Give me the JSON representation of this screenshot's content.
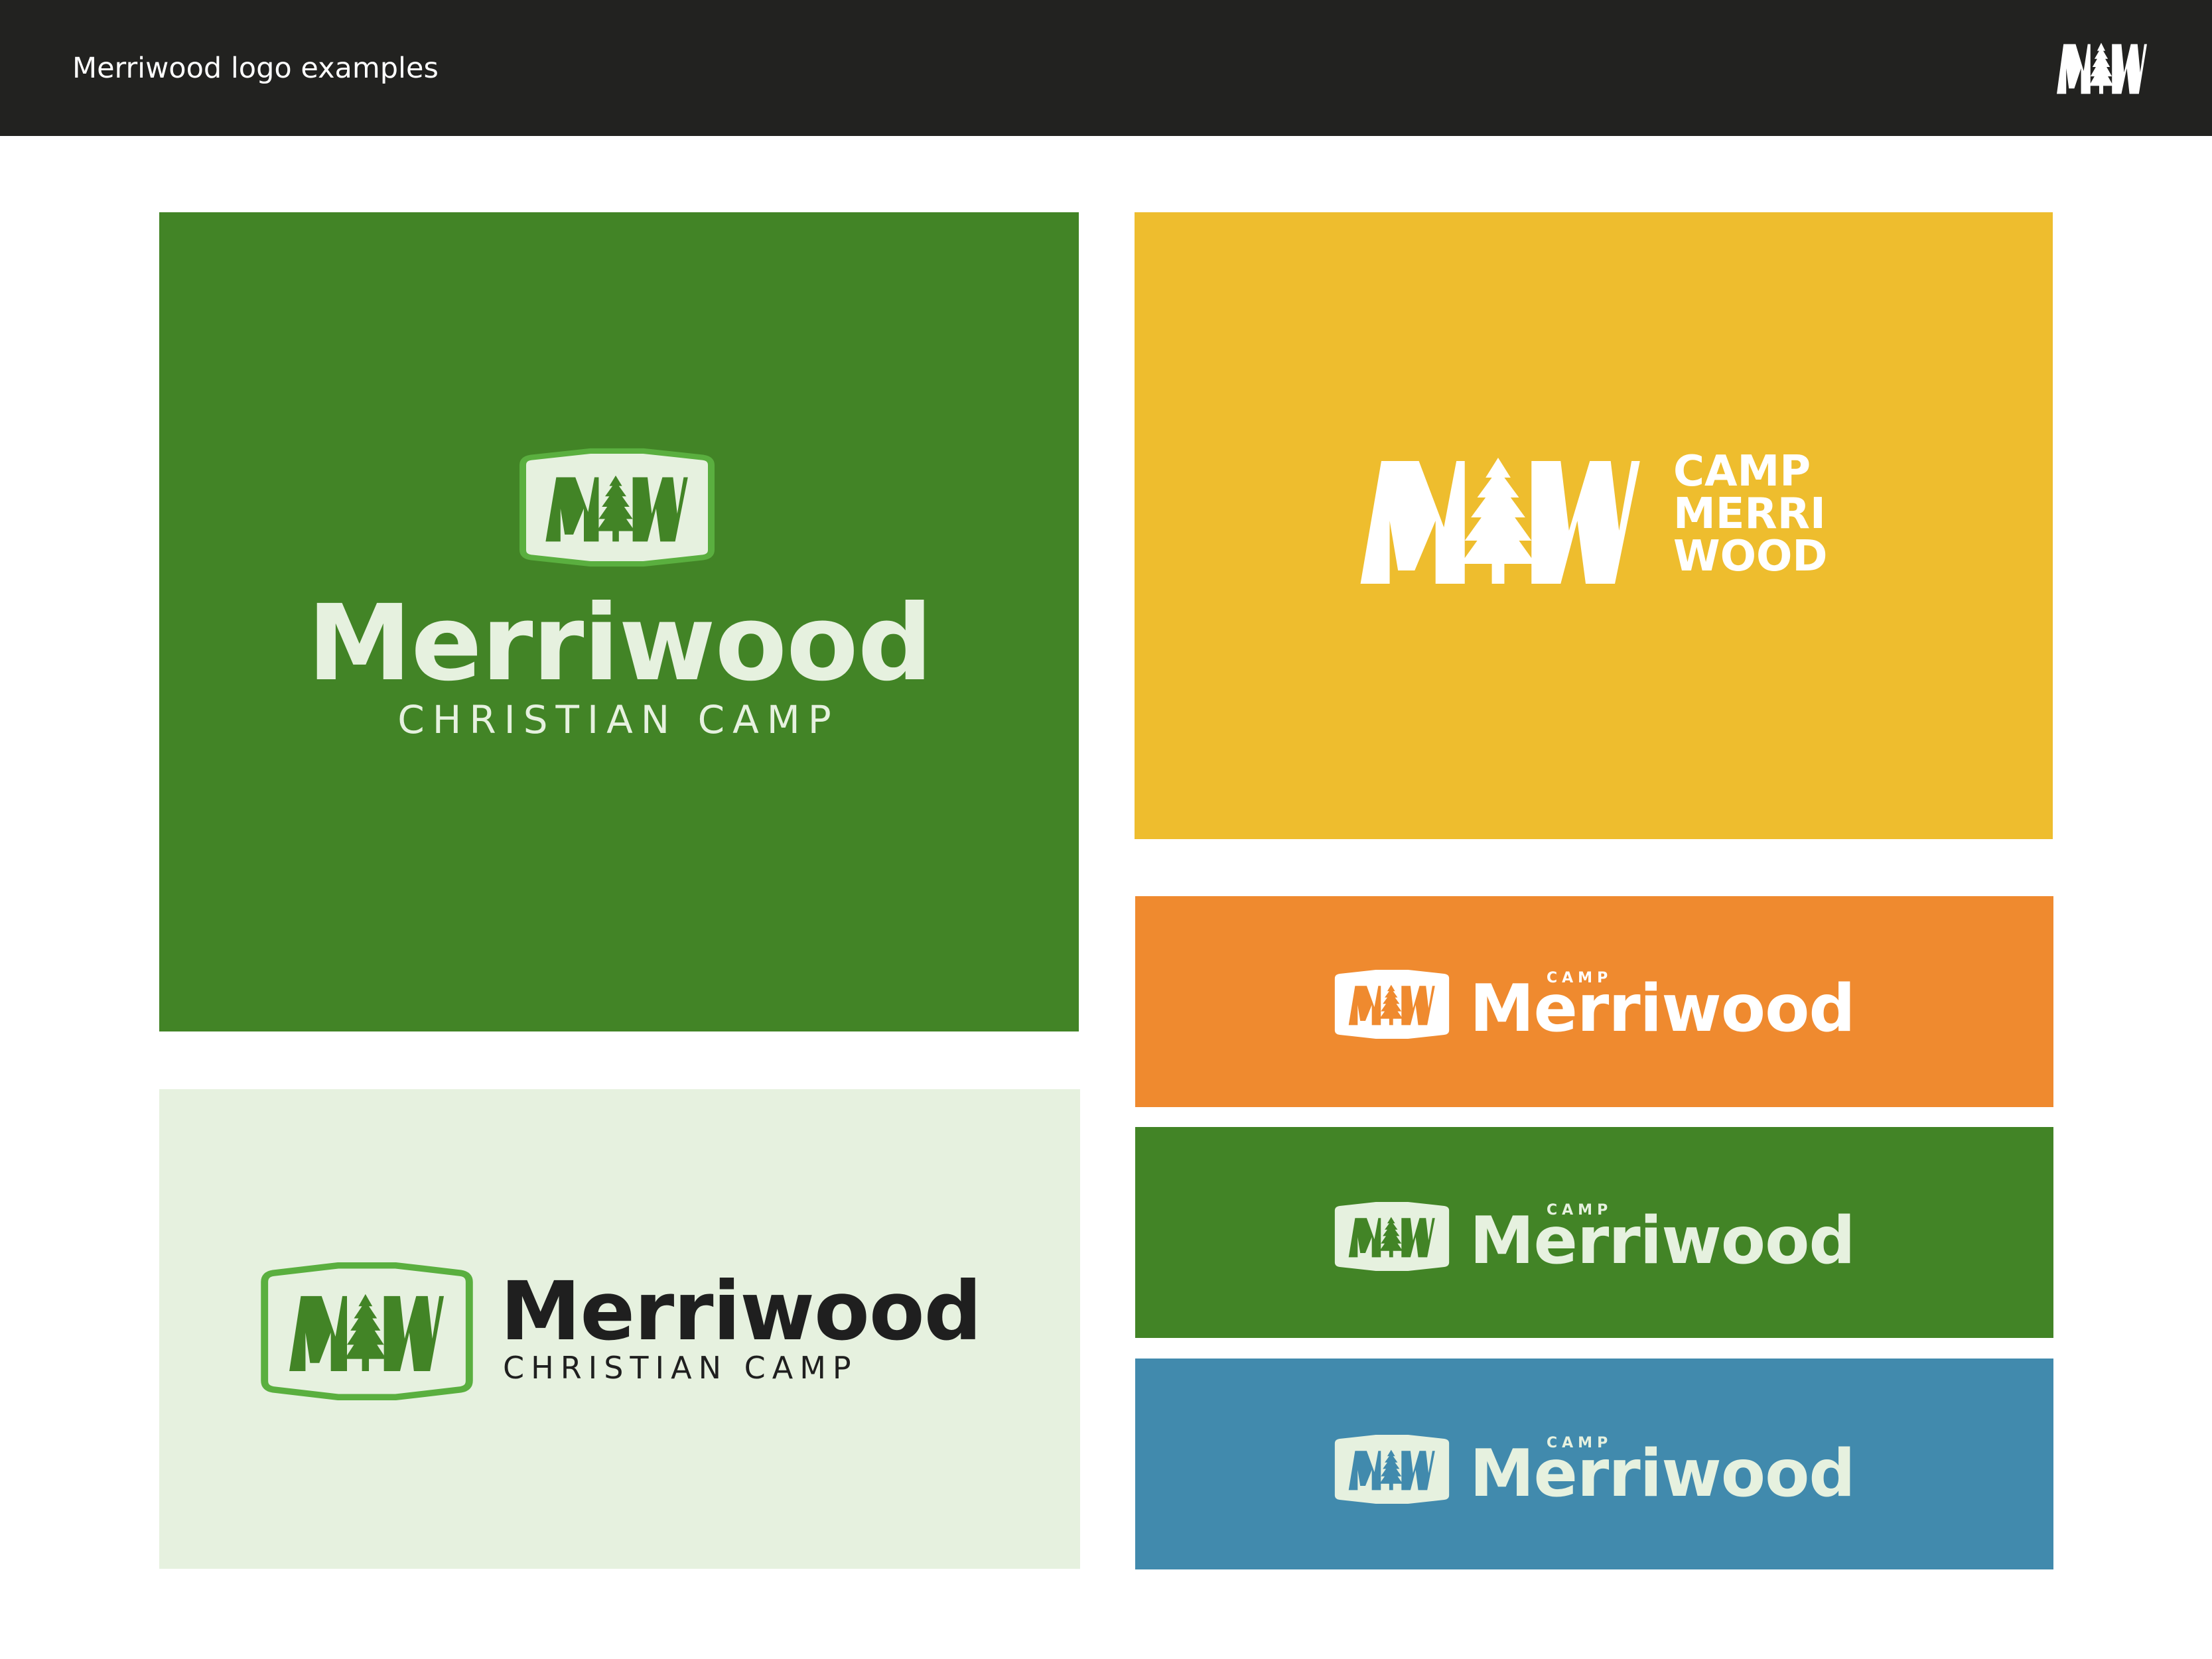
{
  "header": {
    "title": "Merriwood logo examples",
    "logo_icon": "mw-monogram-icon"
  },
  "colors": {
    "topbar": "#222220",
    "green": "#428426",
    "light_green": "#5aaf3f",
    "yellow": "#eebd2e",
    "orange": "#ef8a2f",
    "blue": "#418aad",
    "mint": "#e6f1df",
    "cream": "#e6f1df",
    "dark": "#1f1f1f"
  },
  "panels": {
    "primary_stacked": {
      "wordmark": "Merriwood",
      "tagline": "CHRISTIAN CAMP",
      "badge_icon": "mw-badge-icon"
    },
    "camp_stacked": {
      "line1": "CAMP",
      "line2": "MERRI",
      "line3": "WOOD",
      "monogram_icon": "mw-monogram-icon"
    },
    "horizontal_light": {
      "wordmark": "Merriwood",
      "tagline": "CHRISTIAN CAMP",
      "badge_icon": "mw-badge-icon"
    },
    "camp_horizontal": [
      {
        "camp": "CAMP",
        "wordmark": "Merriwood",
        "badge_icon": "mw-badge-icon"
      },
      {
        "camp": "CAMP",
        "wordmark": "Merriwood",
        "badge_icon": "mw-badge-icon"
      },
      {
        "camp": "CAMP",
        "wordmark": "Merriwood",
        "badge_icon": "mw-badge-icon"
      }
    ]
  }
}
